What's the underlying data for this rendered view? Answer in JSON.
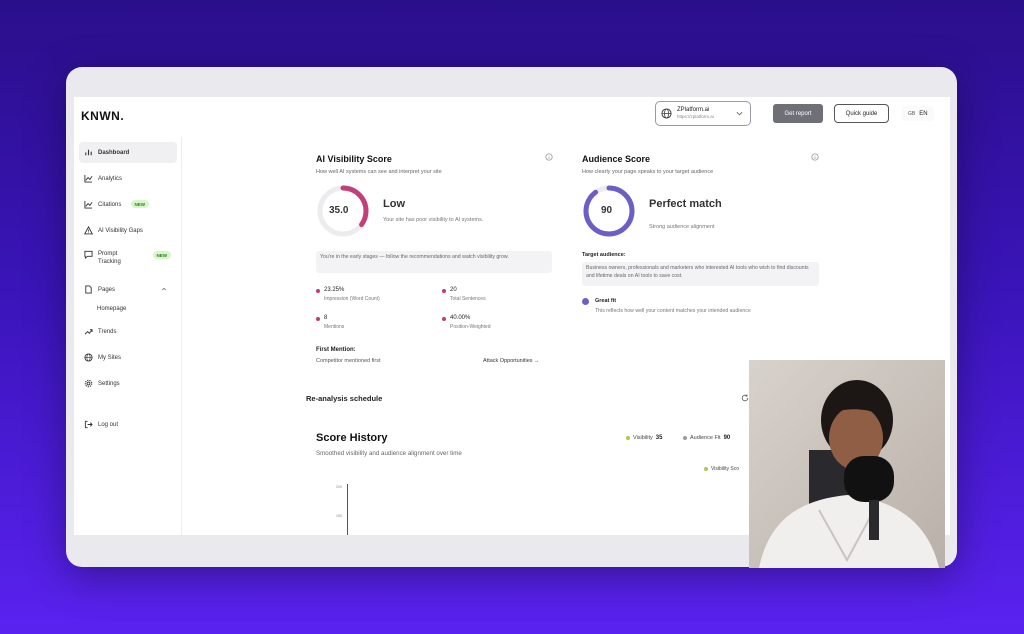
{
  "app": {
    "logo": "KNWN.",
    "site": {
      "name": "ZPlatform.ai",
      "url": "https://zplatform.ai"
    },
    "get_report": "Get report",
    "quick_guide": "Quick guide",
    "lang_flag": "GB",
    "lang": "EN"
  },
  "sidebar": {
    "items": [
      {
        "label": "Dashboard"
      },
      {
        "label": "Analytics"
      },
      {
        "label": "Citations",
        "badge": "NEW"
      },
      {
        "label": "AI Visibility Gaps"
      },
      {
        "label": "Prompt Tracking",
        "badge": "NEW"
      },
      {
        "label": "Pages"
      },
      {
        "label": "Homepage"
      },
      {
        "label": "Trends"
      },
      {
        "label": "My Sites"
      },
      {
        "label": "Settings"
      },
      {
        "label": "Log out"
      }
    ]
  },
  "visibility": {
    "title": "AI Visibility Score",
    "subtitle": "How well AI systems can see and interpret your site",
    "score": "35.0",
    "score_fraction": 0.35,
    "ring_color": "#c2407a",
    "label": "Low",
    "desc": "Your site has poor visibility to AI systems.",
    "hint": "You're in the early stages — follow the recommendations and watch visibility grow.",
    "metrics": [
      {
        "value": "23.25%",
        "label": "Impression (Word Count)"
      },
      {
        "value": "20",
        "label": "Total Sentences"
      },
      {
        "value": "8",
        "label": "Mentions"
      },
      {
        "value": "40.00%",
        "label": "Position-Weighted"
      }
    ],
    "first_mention_title": "First Mention:",
    "first_mention_text": "Competitor mentioned first",
    "attack_link": "Attack Opportunities →"
  },
  "audience": {
    "title": "Audience Score",
    "subtitle": "How clearly your page speaks to your target audience",
    "score": "90",
    "score_fraction": 0.9,
    "ring_color": "#6b5ec6",
    "label": "Perfect match",
    "desc": "Strong audience alignment",
    "target_title": "Target audience:",
    "target_text": "Business owners, professionals and marketers who interested AI tools who wish to find discounts and lifetime deals on AI tools to save cost.",
    "fit_title": "Great fit",
    "fit_desc": "This reflects how well your content matches your intended audience"
  },
  "reanalysis": {
    "title": "Re-analysis schedule"
  },
  "history": {
    "title": "Score History",
    "subtitle": "Smoothed visibility and audience alignment over time",
    "legend": [
      {
        "label": "Visibility",
        "value": "35",
        "color": "#b9c34a"
      },
      {
        "label": "Audience Fit",
        "value": "90",
        "color": "#9a9aa4"
      }
    ],
    "chart_legend": "Visibility Sco",
    "ticks": [
      "200",
      "150"
    ]
  }
}
